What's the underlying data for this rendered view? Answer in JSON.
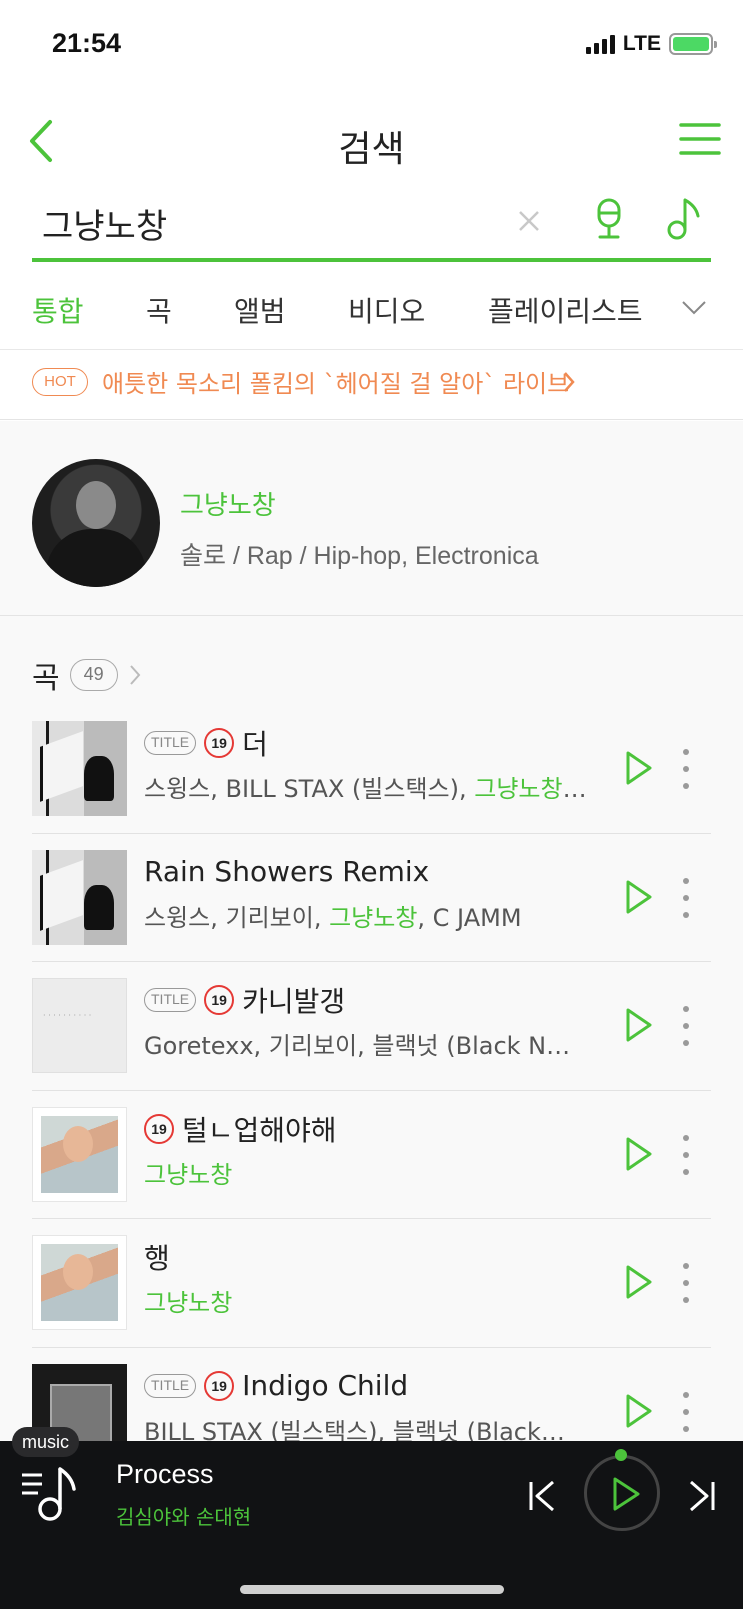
{
  "status_bar": {
    "time": "21:54",
    "network": "LTE"
  },
  "header": {
    "title": "검색"
  },
  "search": {
    "query": "그냥노창"
  },
  "tabs": [
    {
      "label": "통합",
      "active": true
    },
    {
      "label": "곡"
    },
    {
      "label": "앨범"
    },
    {
      "label": "비디오"
    },
    {
      "label": "플레이리스트"
    }
  ],
  "hot": {
    "badge": "HOT",
    "text": "애틋한 목소리 폴킴의 `헤어질 걸 알아` 라이브"
  },
  "artist": {
    "name": "그냥노창",
    "info": "솔로 / Rap / Hip-hop, Electronica"
  },
  "songs_section": {
    "title": "곡",
    "count": "49"
  },
  "badges": {
    "title": "TITLE",
    "age": "19"
  },
  "songs": [
    {
      "title": "더",
      "artists_plain": "스윙스, BILL STAX (빌스택스), ",
      "artists_hl": "그냥노창, …",
      "artists_tail": "",
      "title_badge": true,
      "age_badge": true
    },
    {
      "title": "Rain Showers Remix",
      "artists_plain": "스윙스, 기리보이, ",
      "artists_hl": "그냥노창",
      "artists_tail": ", C JAMM",
      "title_badge": false,
      "age_badge": false
    },
    {
      "title": "카니발갱",
      "artists_plain": "Goretexx, 기리보이, 블랙넛 (Black N…",
      "artists_hl": "",
      "artists_tail": "",
      "title_badge": true,
      "age_badge": true
    },
    {
      "title": "털ㄴ업해야해",
      "artists_plain": "",
      "artists_hl": "그냥노창",
      "artists_tail": "",
      "title_badge": false,
      "age_badge": true
    },
    {
      "title": "행",
      "artists_plain": "",
      "artists_hl": "그냥노창",
      "artists_tail": "",
      "title_badge": false,
      "age_badge": false
    },
    {
      "title": "Indigo Child",
      "artists_plain": "BILL STAX (빌스택스), 블랙넛 (Black…",
      "artists_hl": "",
      "artists_tail": "",
      "title_badge": true,
      "age_badge": true
    }
  ],
  "player": {
    "badge": "music",
    "title": "Process",
    "artist": "김심야와 손대현"
  },
  "colors": {
    "accent": "#4cc33b",
    "hot": "#f08a52",
    "age_badge": "#e53935"
  }
}
